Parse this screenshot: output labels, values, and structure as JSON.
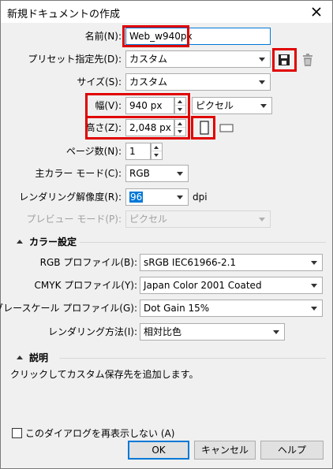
{
  "window": {
    "title": "新規ドキュメントの作成",
    "close_glyph": "✕"
  },
  "fields": {
    "name": {
      "label": "名前(N):",
      "value": "Web_w940px"
    },
    "preset": {
      "label": "プリセット指定先(D):",
      "value": "カスタム"
    },
    "size": {
      "label": "サイズ(S):",
      "value": "カスタム"
    },
    "width": {
      "label": "幅(V):",
      "value": "940 px"
    },
    "height": {
      "label": "高さ(Z):",
      "value": "2,048 px"
    },
    "units": {
      "value": "ピクセル"
    },
    "pages": {
      "label": "ページ数(N):",
      "value": "1"
    },
    "color_mode": {
      "label": "主カラー モード(C):",
      "value": "RGB"
    },
    "resolution": {
      "label": "レンダリング解像度(R):",
      "value": "96",
      "unit": "dpi"
    },
    "preview_mode": {
      "label": "プレビュー モード(P):",
      "value": "ピクセル"
    }
  },
  "color_settings": {
    "header": "カラー設定",
    "rgb_profile": {
      "label": "RGB プロファイル(B):",
      "value": "sRGB IEC61966-2.1"
    },
    "cmyk_profile": {
      "label": "CMYK プロファイル(Y):",
      "value": "Japan Color 2001 Coated"
    },
    "gray_profile": {
      "label": "グレースケール プロファイル(G):",
      "value": "Dot Gain 15%"
    },
    "render_intent": {
      "label": "レンダリング方法(I):",
      "value": "相対比色"
    }
  },
  "description": {
    "header": "説明",
    "text": "クリックしてカスタム保存先を追加します。"
  },
  "footer": {
    "checkbox_label": "このダイアログを再表示しない (A)",
    "ok": "OK",
    "cancel": "キャンセル",
    "help": "ヘルプ"
  },
  "colors": {
    "highlight": "#e00000",
    "selection": "#0078d7"
  }
}
